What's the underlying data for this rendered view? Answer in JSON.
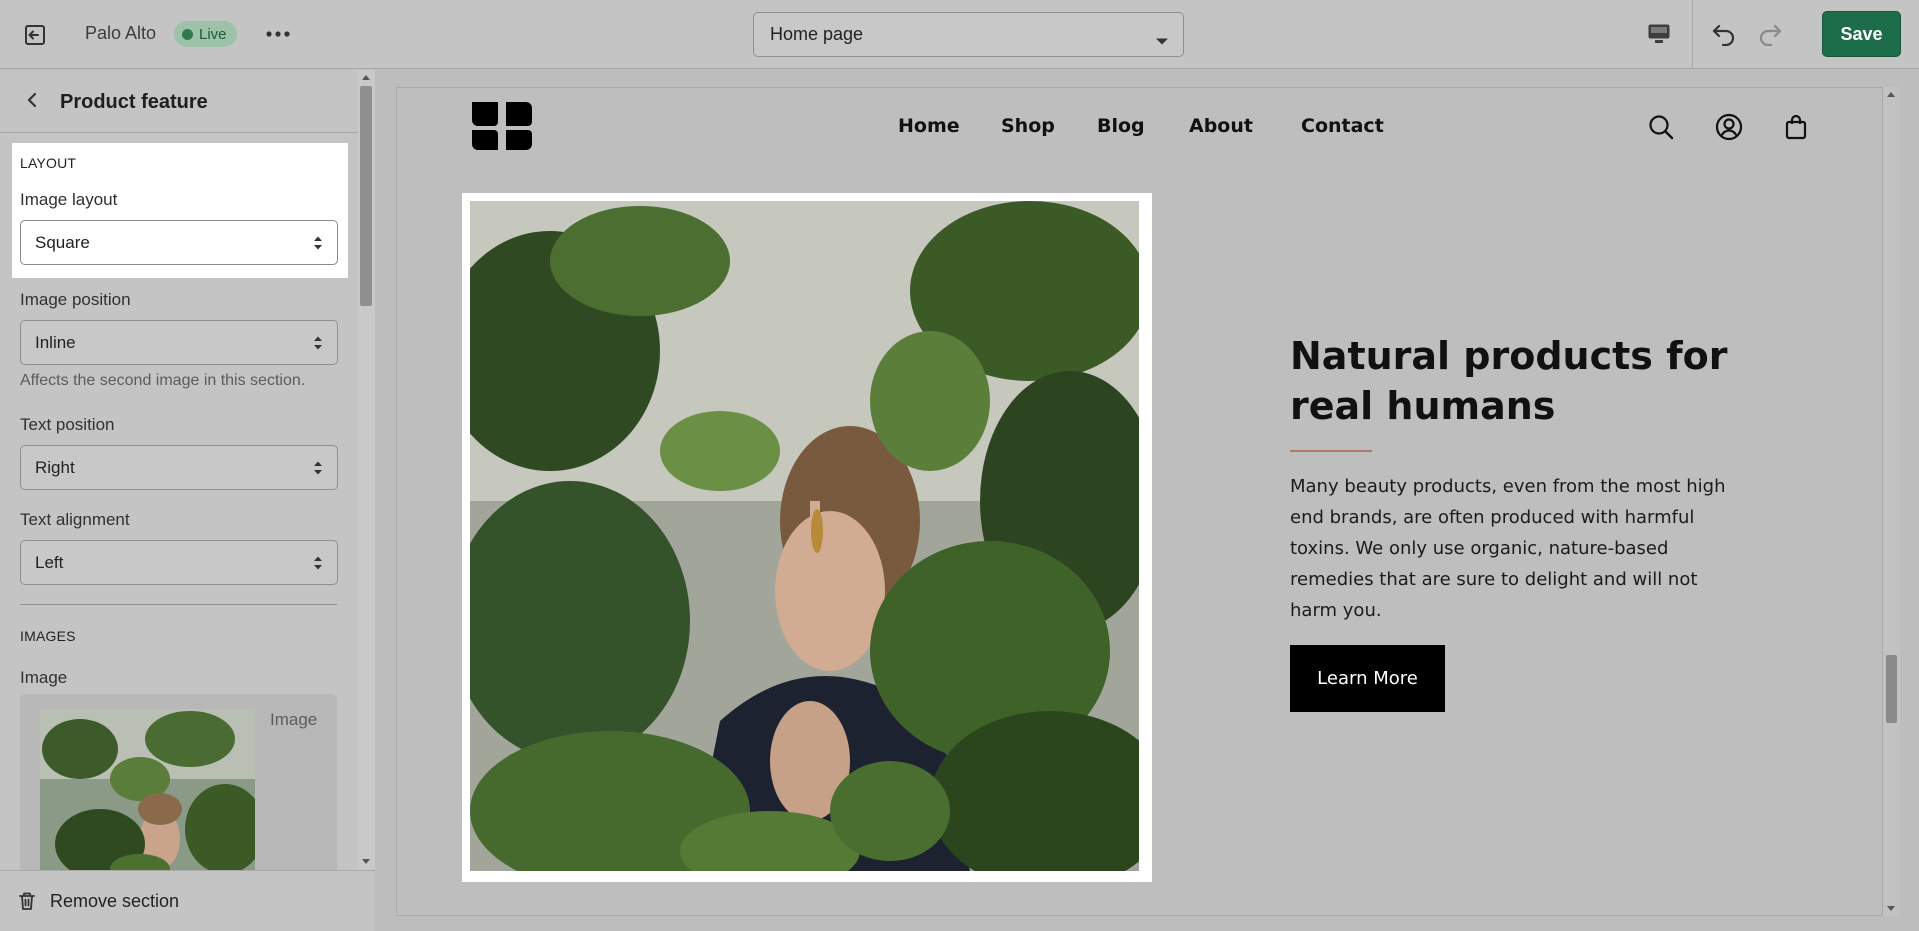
{
  "topbar": {
    "store_name": "Palo Alto",
    "status_badge": "Live",
    "page_select": "Home page",
    "save_label": "Save",
    "icons": [
      "exit-icon",
      "more-icon",
      "desktop-icon",
      "undo-icon",
      "redo-icon",
      "chevron-down-icon"
    ]
  },
  "sidebar": {
    "title": "Product feature",
    "layout_section": "LAYOUT",
    "image_layout": {
      "label": "Image layout",
      "value": "Square"
    },
    "image_position": {
      "label": "Image position",
      "value": "Inline",
      "help": "Affects the second image in this section."
    },
    "text_position": {
      "label": "Text position",
      "value": "Right"
    },
    "text_alignment": {
      "label": "Text alignment",
      "value": "Left"
    },
    "images_section": "IMAGES",
    "image_field_label": "Image",
    "image_card_text": "Image",
    "remove_label": "Remove section"
  },
  "preview": {
    "nav": [
      "Home",
      "Shop",
      "Blog",
      "About",
      "Contact"
    ],
    "heading": "Natural products for real humans",
    "body": "Many beauty products, even from the most high end brands, are often produced with harmful toxins. We only use organic, nature-based remedies that are sure to delight and will not harm you.",
    "cta_label": "Learn More",
    "accent_color": "#b07a66"
  },
  "colors": {
    "save_button": "#1d6d4a",
    "live_badge": "#9cc2a9"
  }
}
